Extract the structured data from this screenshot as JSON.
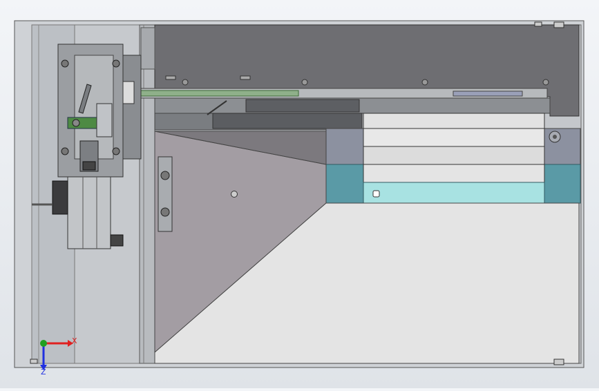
{
  "view": {
    "kind": "cad-assembly-top-view",
    "background": "#e9ecf0",
    "colors": {
      "frame": "#c8cbcf",
      "panel_dark": "#6e6e72",
      "mechanism": "#8f9296",
      "green_bar": "#8fb08a",
      "green_block": "#4e8a44",
      "teal": "#5a9aa6",
      "teal_light": "#a8e2e2",
      "floor": "#e4e4e4",
      "ramp": "#a39da3"
    }
  },
  "triad": {
    "x_label": "X",
    "z_label": "Z",
    "x_color": "#e02020",
    "y_color": "#20a020",
    "z_color": "#2030e0"
  }
}
